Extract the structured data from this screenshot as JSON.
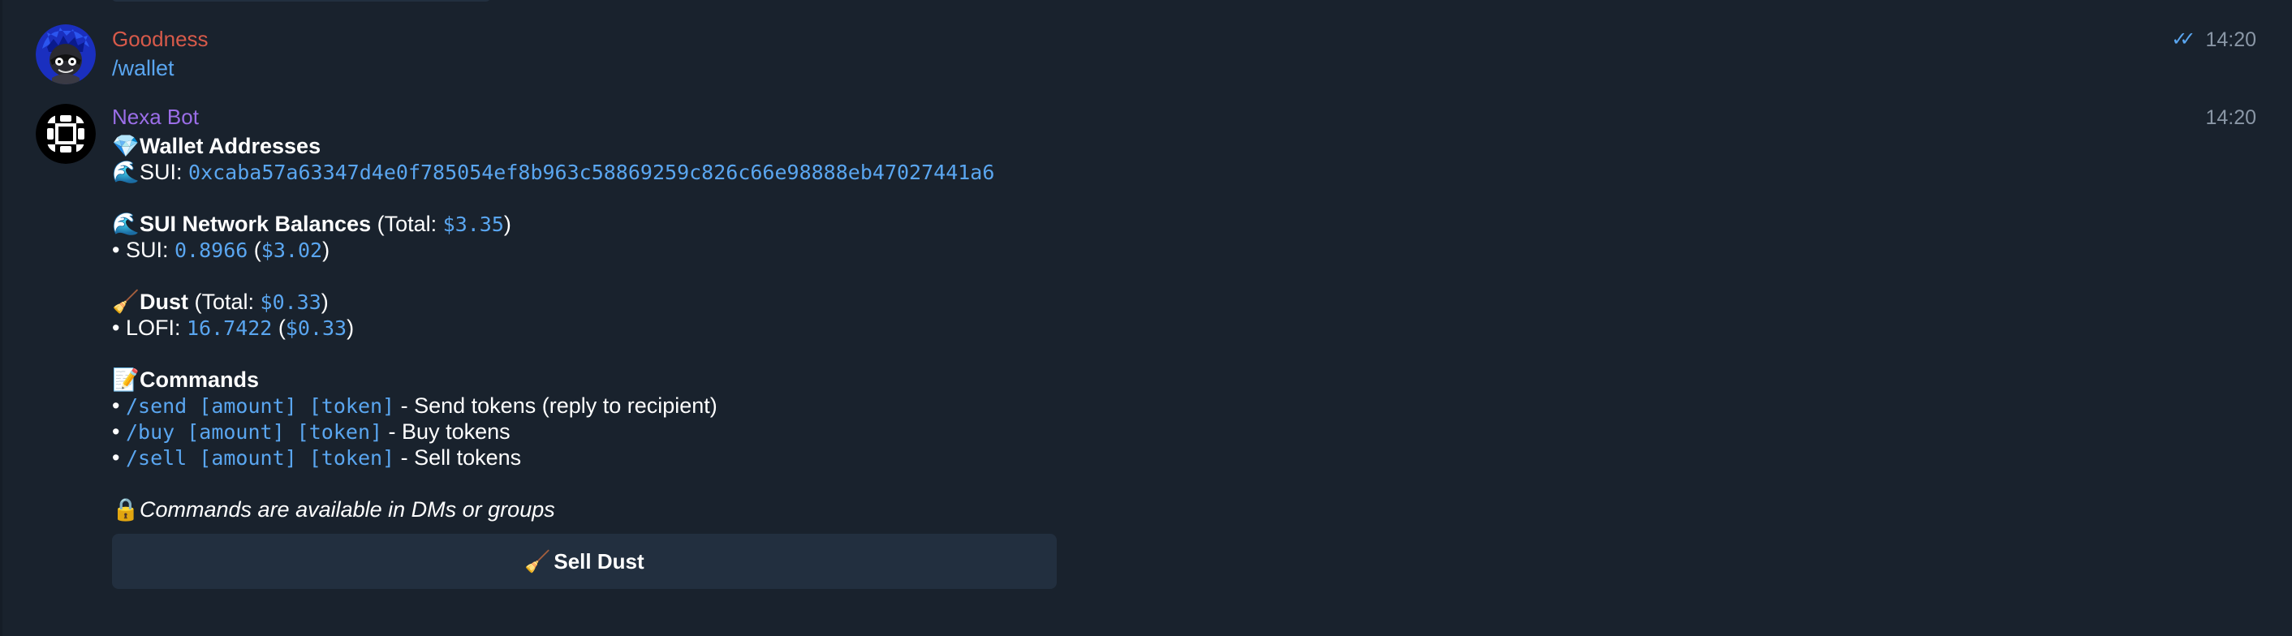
{
  "messages": [
    {
      "sender": "Goodness",
      "sender_color": "#d75a4a",
      "text": "/wallet",
      "time": "14:20",
      "read_status": "double-check"
    },
    {
      "sender": "Nexa Bot",
      "sender_color": "#9b6ee8",
      "time": "14:20",
      "wallet": {
        "heading_emoji": "💎",
        "heading": "Wallet Addresses",
        "sui_emoji": "🌊",
        "sui_label": "SUI: ",
        "sui_address": "0xcaba57a63347d4e0f785054ef8b963c58869259c826c66e98888eb47027441a6"
      },
      "balances": {
        "emoji": "🌊",
        "heading": "SUI Network Balances",
        "total_prefix": " (Total: ",
        "total": "$3.35",
        "total_suffix": ")",
        "items": [
          {
            "bullet": "• ",
            "token": "SUI: ",
            "amount": "0.8966",
            "open": " (",
            "usd": "$3.02",
            "close": ")"
          }
        ]
      },
      "dust": {
        "emoji": "🧹",
        "heading": "Dust",
        "total_prefix": " (Total: ",
        "total": "$0.33",
        "total_suffix": ")",
        "items": [
          {
            "bullet": "• ",
            "token": "LOFI: ",
            "amount": "16.7422",
            "open": " (",
            "usd": "$0.33",
            "close": ")"
          }
        ]
      },
      "commands": {
        "emoji": "📝",
        "heading": "Commands",
        "items": [
          {
            "bullet": "• ",
            "cmd": "/send [amount] [token]",
            "desc": " - Send tokens (reply to recipient)"
          },
          {
            "bullet": "• ",
            "cmd": "/buy [amount] [token]",
            "desc": " - Buy tokens"
          },
          {
            "bullet": "• ",
            "cmd": "/sell [amount] [token]",
            "desc": " - Sell tokens"
          }
        ]
      },
      "note_emoji": "🔒",
      "note": "Commands are available in DMs or groups",
      "button": {
        "emoji": "🧹",
        "label": "Sell Dust"
      }
    }
  ],
  "colors": {
    "background": "#19222d",
    "link": "#5aa6f0",
    "button_bg": "#222f3f"
  }
}
